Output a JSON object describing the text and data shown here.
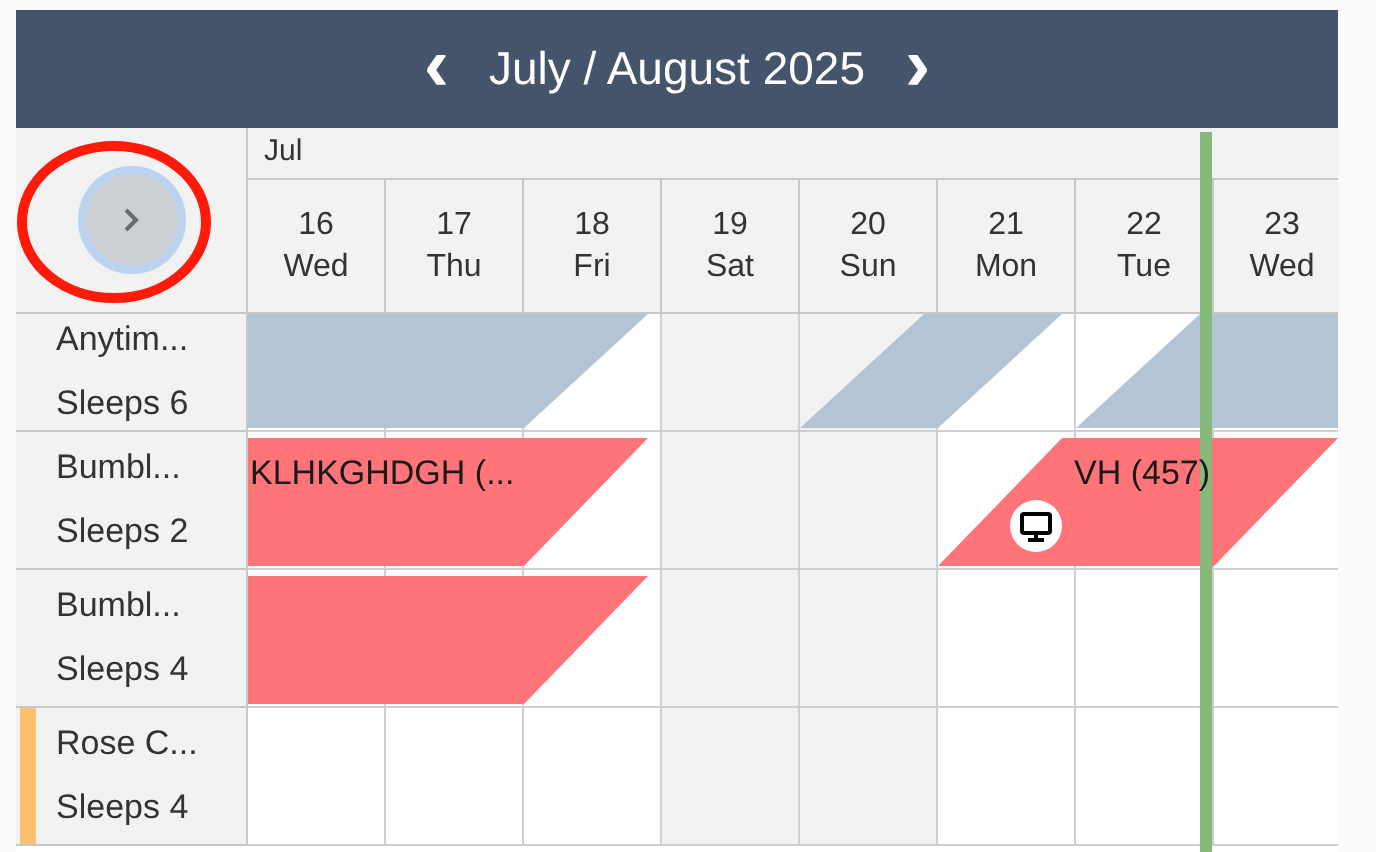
{
  "header": {
    "title": "July / August 2025",
    "prev": "‹",
    "next": "›"
  },
  "month_label": "Jul",
  "days": [
    {
      "date": "16",
      "weekday": "Wed",
      "weekend": false,
      "today": false
    },
    {
      "date": "17",
      "weekday": "Thu",
      "weekend": false,
      "today": false
    },
    {
      "date": "18",
      "weekday": "Fri",
      "weekend": false,
      "today": false
    },
    {
      "date": "19",
      "weekday": "Sat",
      "weekend": true,
      "today": false
    },
    {
      "date": "20",
      "weekday": "Sun",
      "weekend": true,
      "today": false
    },
    {
      "date": "21",
      "weekday": "Mon",
      "weekend": false,
      "today": false
    },
    {
      "date": "22",
      "weekday": "Tue",
      "weekend": false,
      "today": true
    },
    {
      "date": "23",
      "weekday": "Wed",
      "weekend": false,
      "today": false
    }
  ],
  "rows": [
    {
      "name": "Anytim...",
      "sleeps": "Sleeps 6",
      "color": null,
      "cells": [
        {
          "booked": true
        },
        {
          "booked": true
        },
        {
          "booked": false
        },
        {
          "booked": false
        },
        {
          "booked": true
        },
        {
          "booked": false
        },
        {
          "booked": true
        },
        {
          "booked": true
        }
      ],
      "bookings": [
        {
          "kind": "blocked"
        },
        {
          "kind": "blocked"
        },
        {
          "kind": "blocked"
        }
      ]
    },
    {
      "name": "Bumbl...",
      "sleeps": "Sleeps 2",
      "color": null,
      "cells": [
        {
          "booked": true
        },
        {
          "booked": true
        },
        {
          "booked": false
        },
        {
          "booked": false
        },
        {
          "booked": false
        },
        {
          "booked": true
        },
        {
          "booked": true
        },
        {
          "booked": false
        }
      ],
      "bookings": [
        {
          "kind": "reservation",
          "label": "KLHKGHDGH (..."
        },
        {
          "kind": "reservation",
          "label": "VH (457)",
          "online": true
        }
      ]
    },
    {
      "name": "Bumbl...",
      "sleeps": "Sleeps 4",
      "color": null,
      "cells": [
        {
          "booked": true
        },
        {
          "booked": true
        },
        {
          "booked": false
        },
        {
          "booked": false
        },
        {
          "booked": false
        },
        {
          "booked": false
        },
        {
          "booked": false
        },
        {
          "booked": false
        }
      ],
      "bookings": [
        {
          "kind": "reservation"
        }
      ]
    },
    {
      "name": "Rose C...",
      "sleeps": "Sleeps 4",
      "color": "#ffbf70",
      "cells": [
        {
          "booked": false
        },
        {
          "booked": false
        },
        {
          "booked": false
        },
        {
          "booked": false
        },
        {
          "booked": false
        },
        {
          "booked": false
        },
        {
          "booked": false
        },
        {
          "booked": false
        }
      ],
      "bookings": []
    }
  ],
  "highlight": {
    "kind": "ellipse"
  }
}
